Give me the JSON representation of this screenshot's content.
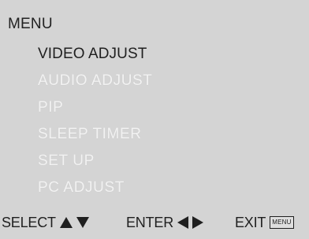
{
  "menu": {
    "title": "MENU",
    "items": [
      {
        "label": "VIDEO ADJUST",
        "selected": true
      },
      {
        "label": "AUDIO  ADJUST",
        "selected": false
      },
      {
        "label": "PIP",
        "selected": false
      },
      {
        "label": "SLEEP  TIMER",
        "selected": false
      },
      {
        "label": "SET  UP",
        "selected": false
      },
      {
        "label": "PC  ADJUST",
        "selected": false
      }
    ]
  },
  "footer": {
    "select_label": "SELECT",
    "enter_label": "ENTER",
    "exit_label": "EXIT",
    "menu_key_label": "MENU"
  },
  "icons": {
    "select": [
      "up-triangle-icon",
      "down-triangle-icon"
    ],
    "enter": [
      "left-triangle-icon",
      "right-triangle-icon"
    ]
  },
  "colors": {
    "background": "#d4d4d4",
    "text_selected": "#1f1f1f",
    "text_unselected": "#f2f2f2"
  }
}
